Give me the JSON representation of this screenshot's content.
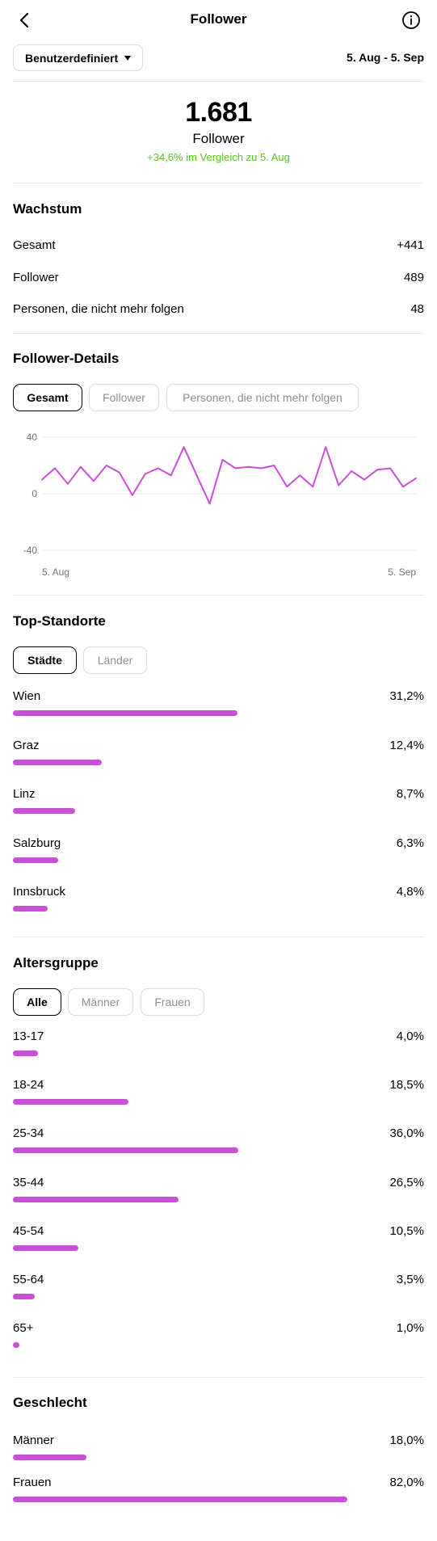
{
  "header": {
    "title": "Follower"
  },
  "filter": {
    "range_label": "Benutzerdefiniert",
    "date_range": "5. Aug - 5. Sep"
  },
  "summary": {
    "count": "1.681",
    "label": "Follower",
    "change": "+34,6% im Vergleich zu 5. Aug"
  },
  "growth": {
    "title": "Wachstum",
    "rows": [
      {
        "label": "Gesamt",
        "value": "+441"
      },
      {
        "label": "Follower",
        "value": "489"
      },
      {
        "label": "Personen, die nicht mehr folgen",
        "value": "48"
      }
    ]
  },
  "details": {
    "title": "Follower-Details",
    "tabs": [
      "Gesamt",
      "Follower",
      "Personen, die nicht mehr folgen"
    ],
    "active_tab": 0
  },
  "chart_data": {
    "type": "line",
    "x_tick_labels": [
      "5. Aug",
      "5. Sep"
    ],
    "y_tick_labels": [
      "40",
      "0",
      "-40"
    ],
    "ylim": [
      -40,
      40
    ],
    "color": "#c94fd8",
    "series": [
      {
        "values": [
          10,
          18,
          7,
          19,
          9,
          20,
          15,
          -1,
          14,
          18,
          13,
          33,
          13,
          -7,
          24,
          18,
          19,
          18,
          20,
          5,
          13,
          5,
          33,
          6,
          16,
          10,
          17,
          18,
          5,
          11
        ]
      }
    ]
  },
  "locations": {
    "title": "Top-Standorte",
    "tabs": [
      "Städte",
      "Länder"
    ],
    "active_tab": 0,
    "items": [
      {
        "label": "Wien",
        "value": "31,2%",
        "share": 31.2
      },
      {
        "label": "Graz",
        "value": "12,4%",
        "share": 12.4
      },
      {
        "label": "Linz",
        "value": "8,7%",
        "share": 8.7
      },
      {
        "label": "Salzburg",
        "value": "6,3%",
        "share": 6.3
      },
      {
        "label": "Innsbruck",
        "value": "4,8%",
        "share": 4.8
      }
    ]
  },
  "age": {
    "title": "Altersgruppe",
    "tabs": [
      "Alle",
      "Männer",
      "Frauen"
    ],
    "active_tab": 0,
    "items": [
      {
        "label": "13-17",
        "value": "4,0%",
        "share": 4.0
      },
      {
        "label": "18-24",
        "value": "18,5%",
        "share": 18.5
      },
      {
        "label": "25-34",
        "value": "36,0%",
        "share": 36.0
      },
      {
        "label": "35-44",
        "value": "26,5%",
        "share": 26.5
      },
      {
        "label": "45-54",
        "value": "10,5%",
        "share": 10.5
      },
      {
        "label": "55-64",
        "value": "3,5%",
        "share": 3.5
      },
      {
        "label": "65+",
        "value": "1,0%",
        "share": 1.0
      }
    ]
  },
  "gender": {
    "title": "Geschlecht",
    "items": [
      {
        "label": "Männer",
        "value": "18,0%",
        "share": 18.0
      },
      {
        "label": "Frauen",
        "value": "82,0%",
        "share": 82.0
      }
    ]
  },
  "colors": {
    "accent": "#c94fd8",
    "positive": "#58c322"
  }
}
